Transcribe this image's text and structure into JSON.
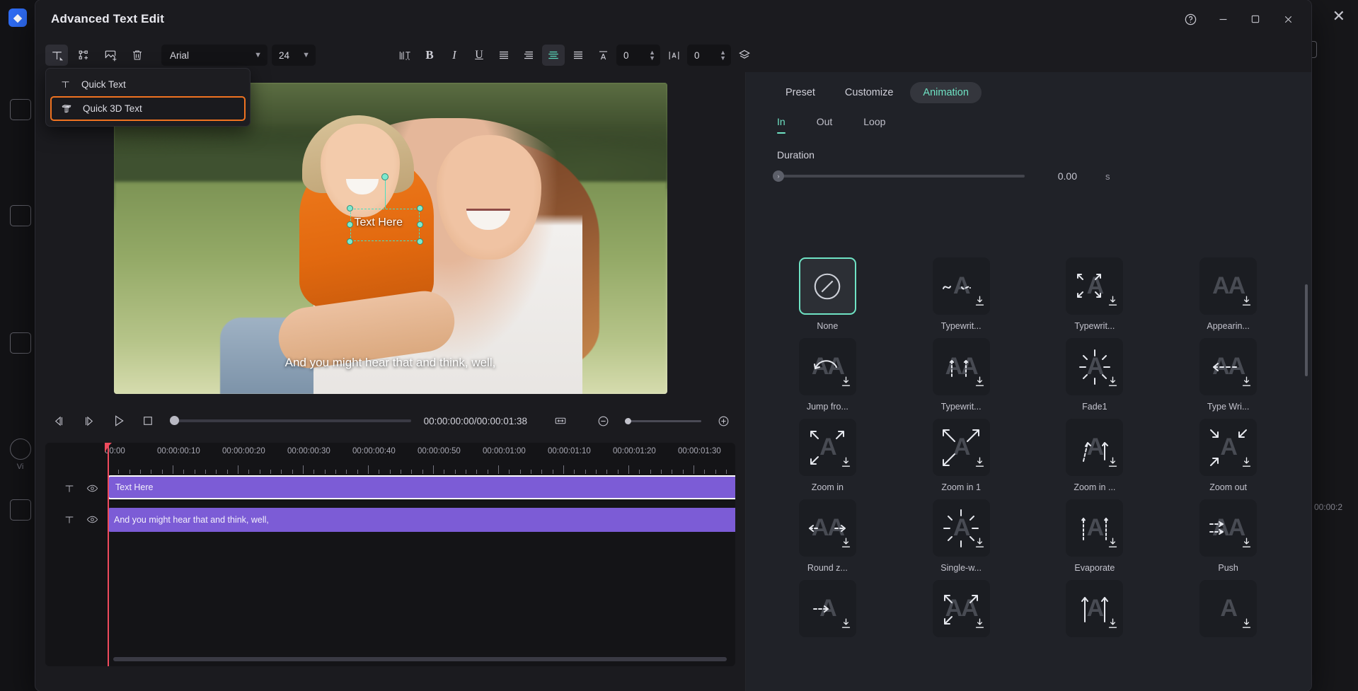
{
  "backdrop": {
    "rail_items": [
      {
        "name": "media-rail-icon",
        "label": ""
      },
      {
        "name": "audio-rail-icon",
        "label": ""
      },
      {
        "name": "text-rail-icon",
        "label": ""
      },
      {
        "name": "video-rail-icon",
        "label": "Vi"
      },
      {
        "name": "effects-rail-icon",
        "label": ""
      }
    ],
    "logo": "◆",
    "close_label": "✕",
    "times": [
      "00:0",
      "00:00:2"
    ]
  },
  "window": {
    "title": "Advanced Text Edit",
    "help_label": "?",
    "minimize_label": "–",
    "maximize_label": "□",
    "close_label": "✕"
  },
  "toolbar": {
    "buttons": [
      {
        "name": "add-text-button",
        "icon": "text-tool-icon",
        "active": true
      },
      {
        "name": "add-shape-button",
        "icon": "shape-add-icon",
        "active": false
      },
      {
        "name": "add-image-button",
        "icon": "image-add-icon",
        "active": false
      },
      {
        "name": "delete-button",
        "icon": "trash-icon",
        "active": false
      }
    ],
    "font_family": "Arial",
    "font_size": "24",
    "format_buttons": [
      {
        "name": "text-spacing-button",
        "icon": "text-spacing-icon",
        "active": false
      },
      {
        "name": "bold-button",
        "icon": "bold-icon",
        "label": "B",
        "active": false
      },
      {
        "name": "italic-button",
        "icon": "italic-icon",
        "label": "I",
        "active": false
      },
      {
        "name": "underline-button",
        "icon": "underline-icon",
        "label": "U",
        "active": false
      },
      {
        "name": "align-left-button",
        "icon": "align-left-icon",
        "active": false
      },
      {
        "name": "align-right-button",
        "icon": "align-right-icon",
        "active": false
      },
      {
        "name": "align-center-button",
        "icon": "align-center-icon",
        "active": true
      },
      {
        "name": "align-justify-button",
        "icon": "align-justify-icon",
        "active": false
      }
    ],
    "line_spacing_icon": "line-height-icon",
    "line_spacing_value": "0",
    "letter_spacing_icon": "letter-spacing-icon",
    "letter_spacing_value": "0",
    "layers_icon": "layers-icon"
  },
  "dropdown": {
    "items": [
      {
        "name": "menu-item-quick-text",
        "label": "Quick Text",
        "icon": "text-icon",
        "highlighted": false
      },
      {
        "name": "menu-item-quick-3d-text",
        "label": "Quick 3D Text",
        "icon": "text-3d-icon",
        "highlighted": true
      }
    ],
    "highlight_color": "#f07321"
  },
  "preview": {
    "caption": "And you might hear that and think, well,",
    "selected_text": "Text Here",
    "selection_color": "#49e0c0"
  },
  "player": {
    "buttons": [
      {
        "name": "previous-frame-button",
        "icon": "prev-frame-icon"
      },
      {
        "name": "next-frame-button",
        "icon": "next-frame-icon"
      },
      {
        "name": "play-button",
        "icon": "play-icon"
      },
      {
        "name": "stop-button",
        "icon": "stop-icon"
      }
    ],
    "timecode": "00:00:00:00/00:00:01:38",
    "fit_icon": "fit-to-screen-icon",
    "zoom_out_icon": "zoom-out-icon",
    "zoom_in_icon": "zoom-in-icon"
  },
  "timeline": {
    "ruler_labels": [
      "00:00",
      "00:00:00:10",
      "00:00:00:20",
      "00:00:00:30",
      "00:00:00:40",
      "00:00:00:50",
      "00:00:01:00",
      "00:00:01:10",
      "00:00:01:20",
      "00:00:01:30"
    ],
    "tracks": [
      {
        "name": "track-row-1",
        "type_icon": "text-icon",
        "eye_icon": "eye-icon",
        "clip_label": "Text Here",
        "selected": true
      },
      {
        "name": "track-row-2",
        "type_icon": "text-icon",
        "eye_icon": "eye-icon",
        "clip_label": "And you might hear that and think, well,",
        "selected": false
      }
    ],
    "clip_color": "#7c5cd6",
    "playhead_color": "#ef4b5d"
  },
  "right_panel": {
    "tabs": [
      {
        "name": "tab-preset",
        "label": "Preset",
        "active": false
      },
      {
        "name": "tab-customize",
        "label": "Customize",
        "active": false
      },
      {
        "name": "tab-animation",
        "label": "Animation",
        "active": true
      }
    ],
    "subtabs": [
      {
        "name": "subtab-in",
        "label": "In",
        "active": true
      },
      {
        "name": "subtab-out",
        "label": "Out",
        "active": false
      },
      {
        "name": "subtab-loop",
        "label": "Loop",
        "active": false
      }
    ],
    "duration_label": "Duration",
    "duration_value": "0.00",
    "duration_unit": "s",
    "accent_color": "#6fe3c4",
    "animations": [
      {
        "name": "anim-none",
        "label": "None",
        "icon": "none-circle-slash-icon",
        "selected": true,
        "downloadable": false
      },
      {
        "name": "anim-typewriter-1",
        "label": "Typewrit...",
        "icon": "typewriter-wave-icon",
        "selected": false,
        "downloadable": true
      },
      {
        "name": "anim-typewriter-2",
        "label": "Typewrit...",
        "icon": "typewriter-expand-icon",
        "selected": false,
        "downloadable": true
      },
      {
        "name": "anim-appearing",
        "label": "Appearin...",
        "icon": "appearing-double-a-icon",
        "selected": false,
        "downloadable": true
      },
      {
        "name": "anim-jump-from",
        "label": "Jump fro...",
        "icon": "jump-arc-icon",
        "selected": false,
        "downloadable": true
      },
      {
        "name": "anim-typewriter-3",
        "label": "Typewrit...",
        "icon": "typewriter-up-icon",
        "selected": false,
        "downloadable": true
      },
      {
        "name": "anim-fade1",
        "label": "Fade1",
        "icon": "fade-burst-icon",
        "selected": false,
        "downloadable": true
      },
      {
        "name": "anim-type-write",
        "label": "Type Wri...",
        "icon": "typewrite-left-icon",
        "selected": false,
        "downloadable": true
      },
      {
        "name": "anim-zoom-in",
        "label": "Zoom in",
        "icon": "zoom-in-arrows-icon",
        "selected": false,
        "downloadable": true
      },
      {
        "name": "anim-zoom-in-1",
        "label": "Zoom in 1",
        "icon": "zoom-in-diag-icon",
        "selected": false,
        "downloadable": true
      },
      {
        "name": "anim-zoom-in-2",
        "label": "Zoom in ...",
        "icon": "zoom-in-beam-icon",
        "selected": false,
        "downloadable": true
      },
      {
        "name": "anim-zoom-out",
        "label": "Zoom out",
        "icon": "zoom-out-arrows-icon",
        "selected": false,
        "downloadable": true
      },
      {
        "name": "anim-round-zoom",
        "label": "Round z...",
        "icon": "round-zoom-icon",
        "selected": false,
        "downloadable": true
      },
      {
        "name": "anim-single-w",
        "label": "Single-w...",
        "icon": "single-word-icon",
        "selected": false,
        "downloadable": true
      },
      {
        "name": "anim-evaporate",
        "label": "Evaporate",
        "icon": "evaporate-icon",
        "selected": false,
        "downloadable": true
      },
      {
        "name": "anim-push",
        "label": "Push",
        "icon": "push-arrows-icon",
        "selected": false,
        "downloadable": true
      },
      {
        "name": "anim-row5-1",
        "label": "",
        "icon": "fly-in-icon",
        "selected": false,
        "downloadable": true
      },
      {
        "name": "anim-row5-2",
        "label": "",
        "icon": "spread-icon",
        "selected": false,
        "downloadable": true
      },
      {
        "name": "anim-row5-3",
        "label": "",
        "icon": "rise-up-icon",
        "selected": false,
        "downloadable": true
      },
      {
        "name": "anim-row5-4",
        "label": "",
        "icon": "plain-a-icon",
        "selected": false,
        "downloadable": true
      }
    ]
  }
}
